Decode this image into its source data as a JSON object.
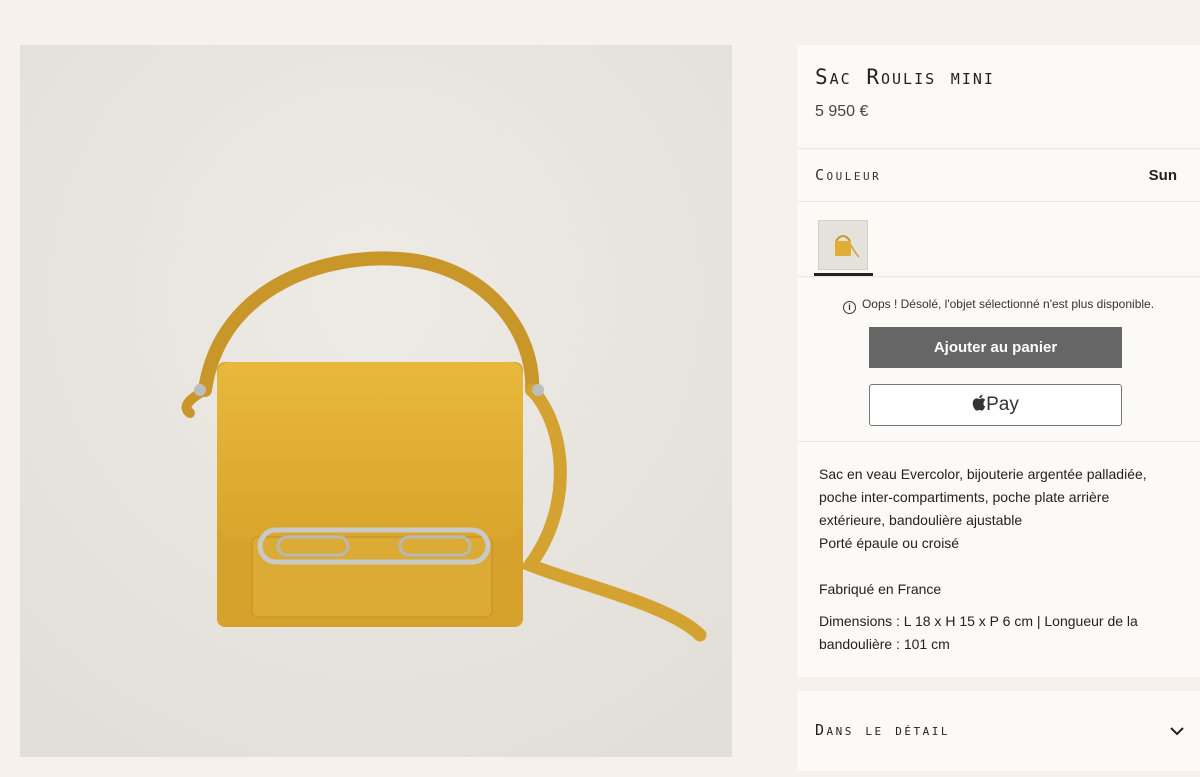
{
  "product": {
    "title": "Sac Roulis mini",
    "price": "5 950 €"
  },
  "color": {
    "label": "Couleur",
    "value": "Sun",
    "accent": "#e4b53a"
  },
  "availability": {
    "icon": "info-icon",
    "message": "Oops ! Désolé, l'objet sélectionné n'est plus disponible."
  },
  "actions": {
    "cart_label": "Ajouter au panier",
    "pay_label": "Pay",
    "pay_icon": "apple-icon"
  },
  "description": {
    "lines": [
      "Sac en veau Evercolor, bijouterie argentée palladiée,",
      "poche inter-compartiments, poche plate arrière",
      "extérieure, bandoulière ajustable",
      "Porté épaule ou croisé"
    ],
    "origin": "Fabriqué en France",
    "dimensions": "Dimensions : L 18 x H 15 x P 6 cm | Longueur de la bandoulière : 101 cm"
  },
  "detail_section": {
    "label": "Dans le détail",
    "icon": "chevron-down-icon"
  }
}
